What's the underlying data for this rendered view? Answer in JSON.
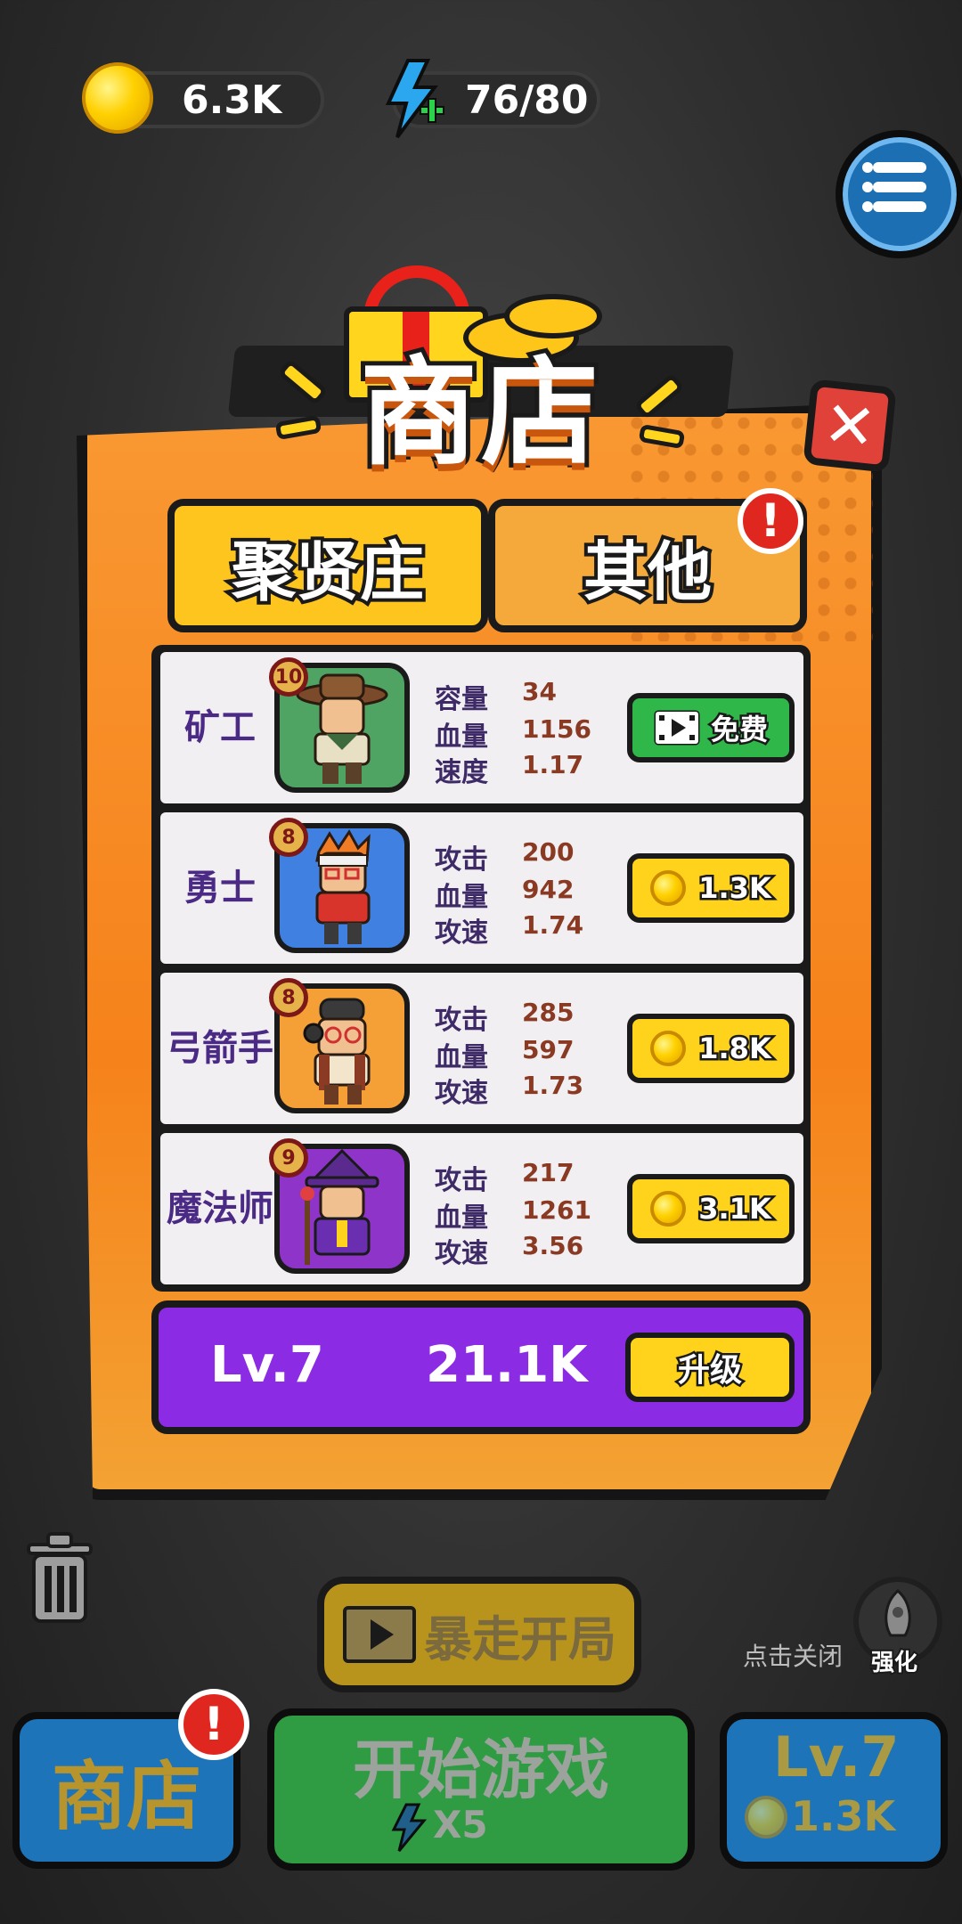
{
  "hud": {
    "gold": "6.3K",
    "energy": "76/80"
  },
  "dialog": {
    "title": "商店",
    "tabs": [
      {
        "label": "聚贤庄"
      },
      {
        "label": "其他"
      }
    ],
    "alert_mark": "!",
    "rows": [
      {
        "name": "矿工",
        "level": "10",
        "stats": [
          {
            "label": "容量",
            "value": "34"
          },
          {
            "label": "血量",
            "value": "1156"
          },
          {
            "label": "速度",
            "value": "1.17"
          }
        ],
        "button": {
          "label": "免费",
          "style": "free"
        }
      },
      {
        "name": "勇士",
        "level": "8",
        "stats": [
          {
            "label": "攻击",
            "value": "200"
          },
          {
            "label": "血量",
            "value": "942"
          },
          {
            "label": "攻速",
            "value": "1.74"
          }
        ],
        "button": {
          "label": "1.3K",
          "style": "gold"
        }
      },
      {
        "name": "弓箭手",
        "level": "8",
        "stats": [
          {
            "label": "攻击",
            "value": "285"
          },
          {
            "label": "血量",
            "value": "597"
          },
          {
            "label": "攻速",
            "value": "1.73"
          }
        ],
        "button": {
          "label": "1.8K",
          "style": "gold"
        }
      },
      {
        "name": "魔法师",
        "level": "9",
        "stats": [
          {
            "label": "攻击",
            "value": "217"
          },
          {
            "label": "血量",
            "value": "1261"
          },
          {
            "label": "攻速",
            "value": "3.56"
          }
        ],
        "button": {
          "label": "3.1K",
          "style": "gold"
        }
      }
    ],
    "upgrade": {
      "level": "Lv.7",
      "cost": "21.1K",
      "button": "升级"
    }
  },
  "bottom": {
    "rush_label": "暴走开局",
    "tap_close": "点击关闭",
    "boost_label": "强化",
    "shop_label": "商店",
    "start_label": "开始游戏",
    "start_cost": "X5",
    "level_label": "Lv.7",
    "level_cost": "1.3K"
  },
  "colors": {
    "dialog": "#f6821b",
    "tab_active": "#ffc51f",
    "upgrade_bar": "#8b2be3",
    "free_button": "#2fb74a",
    "gold_button": "#ffd21c"
  }
}
